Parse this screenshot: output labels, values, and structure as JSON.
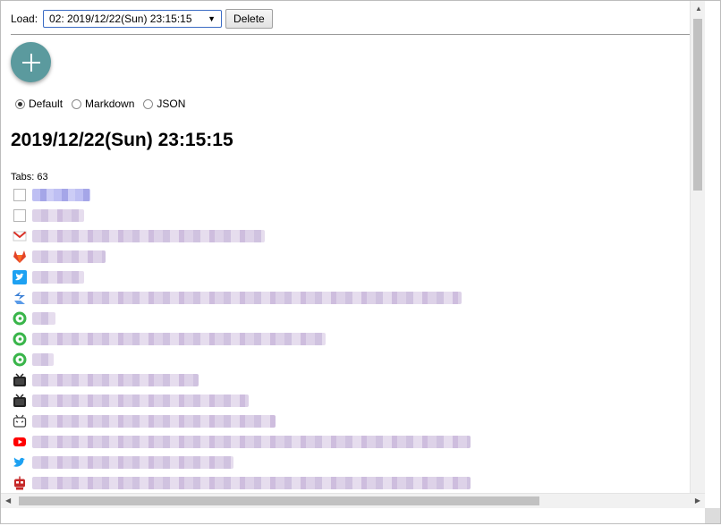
{
  "toolbar": {
    "load_label": "Load:",
    "selected_snapshot": "02: 2019/12/22(Sun) 23:15:15",
    "delete_label": "Delete"
  },
  "format": {
    "options": [
      "Default",
      "Markdown",
      "JSON"
    ],
    "selected": "Default"
  },
  "session": {
    "title": "2019/12/22(Sun) 23:15:15",
    "tabs_count": "Tabs: 63"
  },
  "tabs": [
    {
      "icon": "blank-page-icon",
      "style": "blue"
    },
    {
      "icon": "blank-page-icon",
      "style": "normal"
    },
    {
      "icon": "gmail-icon",
      "style": "normal"
    },
    {
      "icon": "gitlab-icon",
      "style": "normal"
    },
    {
      "icon": "twitter-icon",
      "style": "normal"
    },
    {
      "icon": "zenhub-icon",
      "style": "normal"
    },
    {
      "icon": "green-at-icon",
      "style": "normal"
    },
    {
      "icon": "green-at-icon",
      "style": "normal"
    },
    {
      "icon": "green-at-icon",
      "style": "normal"
    },
    {
      "icon": "niconico-tv-icon",
      "style": "normal"
    },
    {
      "icon": "niconico-tv-icon",
      "style": "normal"
    },
    {
      "icon": "bilibili-tv-icon",
      "style": "normal"
    },
    {
      "icon": "youtube-icon",
      "style": "normal"
    },
    {
      "icon": "twitter-bird-icon",
      "style": "normal"
    },
    {
      "icon": "robot-icon",
      "style": "normal"
    },
    {
      "icon": "robot-icon",
      "style": "normal"
    }
  ],
  "colors": {
    "fab": "#5b9a9e",
    "select_border": "#3c6cc4"
  }
}
